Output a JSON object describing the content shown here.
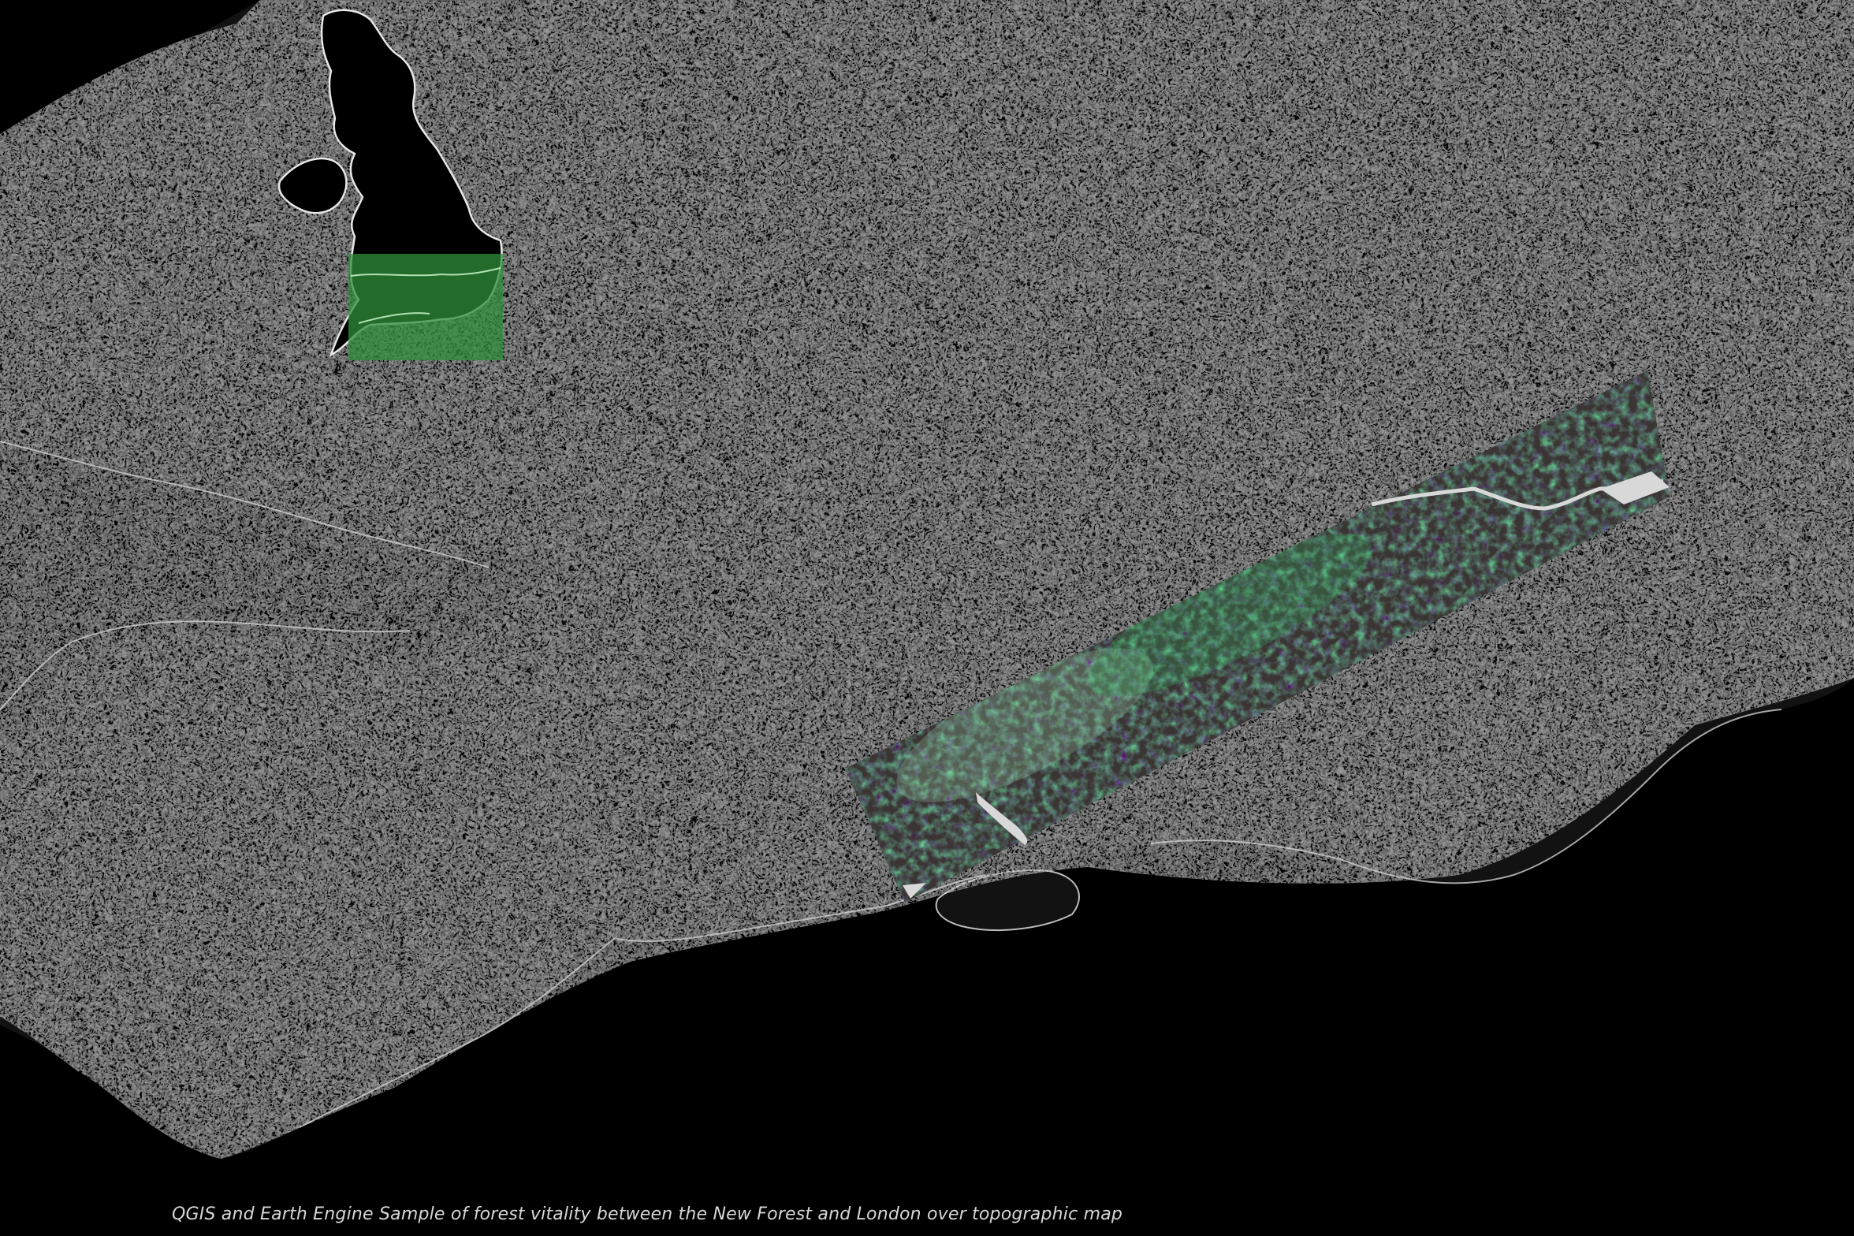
{
  "caption": "QGIS and Earth Engine Sample of forest vitality between the New Forest and London over topographic map",
  "colors": {
    "background": "#000000",
    "contour": "#e8e8e8",
    "vegetation": "#2fa04a",
    "inset_highlight": "#2f8f3a",
    "water": "#d8d8d8"
  }
}
